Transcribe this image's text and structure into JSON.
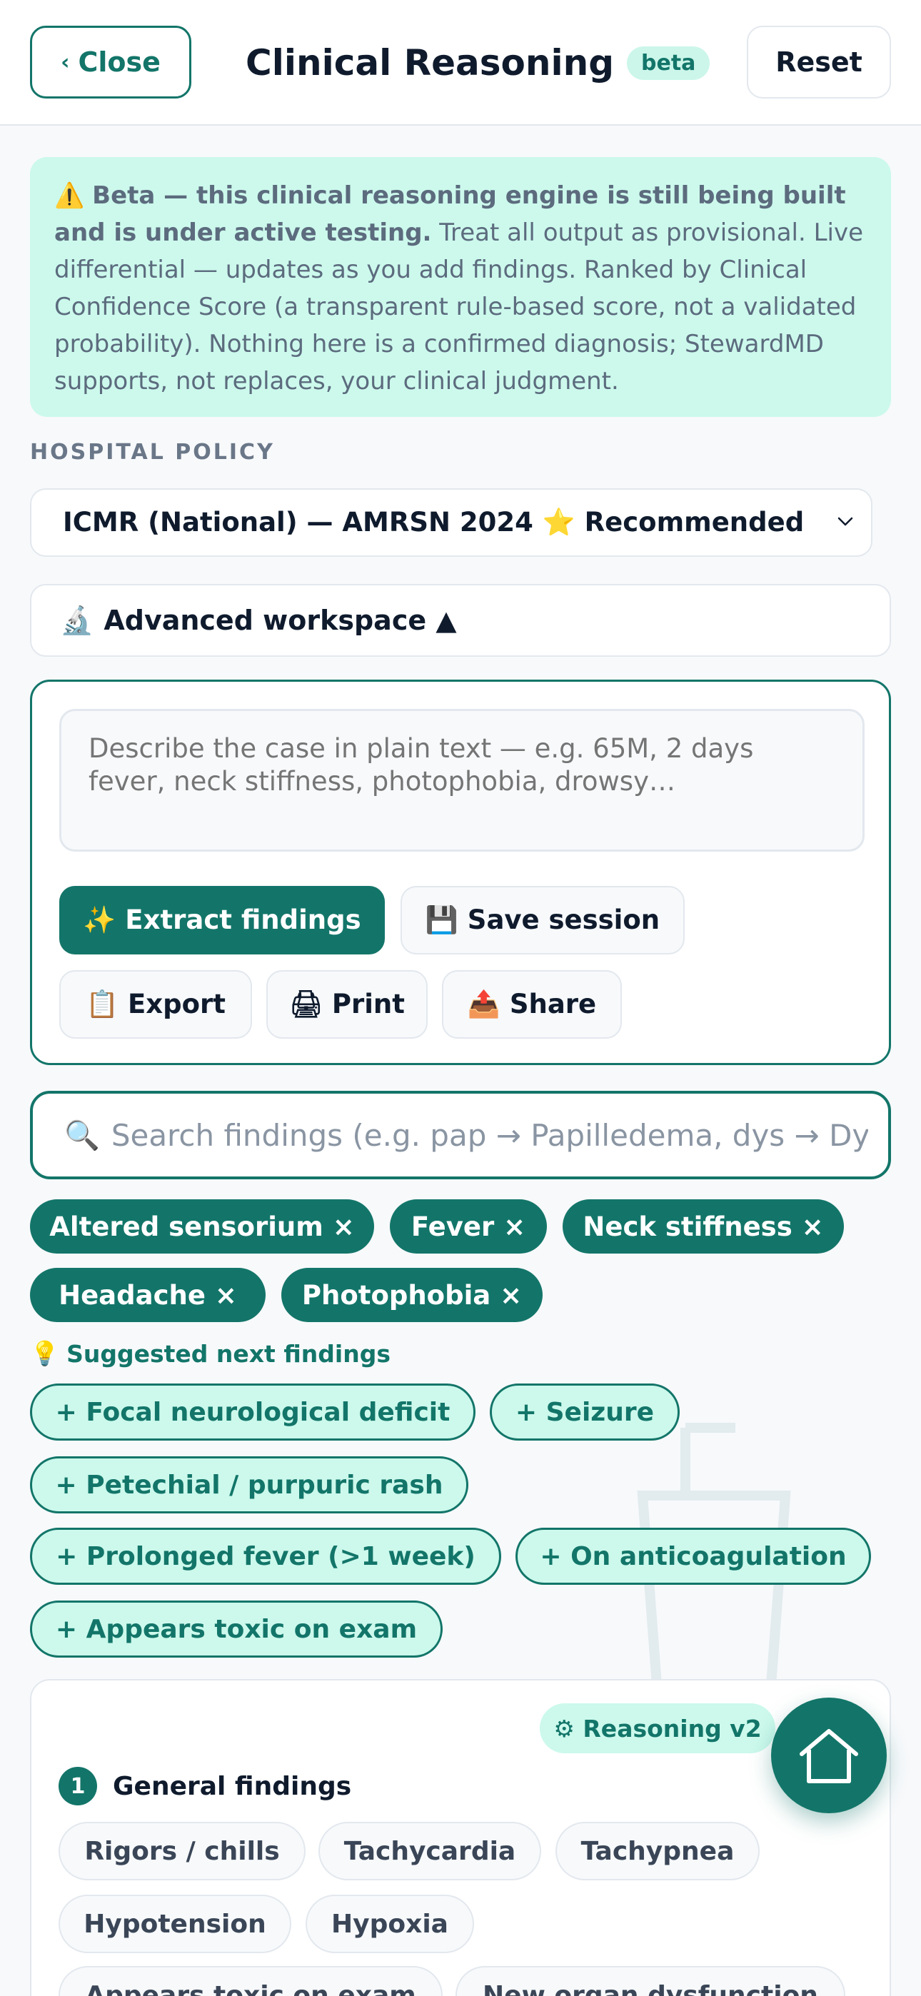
{
  "header": {
    "close_label": "Close",
    "close_chevron": "‹",
    "title": "Clinical Reasoning",
    "badge": "beta",
    "reset_label": "Reset"
  },
  "notice": {
    "icon": "⚠️",
    "bold_text": "Beta — this clinical reasoning engine is still being built and is under active testing.",
    "text": " Treat all output as provisional. Live differential — updates as you add findings. Ranked by Clinical Confidence Score (a transparent rule-based score, not a validated probability). Nothing here is a confirmed diagnosis; StewardMD supports, not replaces, your clinical judgment."
  },
  "policy": {
    "label": "HOSPITAL POLICY",
    "selected": "ICMR (National) — AMRSN 2024 ⭐ Recommended"
  },
  "advanced": {
    "icon": "🔬",
    "label": "Advanced workspace ▲"
  },
  "case": {
    "placeholder": "Describe the case in plain text — e.g. 65M, 2 days fever, neck stiffness, photophobia, drowsy…",
    "extract_label": "✨ Extract findings",
    "save_label": "💾 Save session",
    "export_label": "📋 Export",
    "print_label": "🖨 Print",
    "share_label": "📤 Share"
  },
  "search": {
    "icon": "🔍",
    "placeholder": "Search findings (e.g. pap → Papilledema, dys → Dysarthria)"
  },
  "selected_findings": [
    "Altered sensorium ×",
    "Fever ×",
    "Neck stiffness ×",
    "Headache ×",
    "Photophobia ×"
  ],
  "suggested": {
    "icon": "💡",
    "label": "Suggested next findings",
    "items": [
      "+ Focal neurological deficit",
      "+ Seizure",
      "+ Petechial / purpuric rash",
      "+ Prolonged fever (>1 week)",
      "+ On anticoagulation",
      "+ Appears toxic on exam"
    ]
  },
  "reasoning": {
    "badge": "⚙ Reasoning v2",
    "step_number": "1",
    "step_title": "General findings",
    "chips": [
      "Rigors / chills",
      "Tachycardia",
      "Tachypnea",
      "Hypotension",
      "Hypoxia",
      "Appears toxic on exam",
      "New organ dysfunction"
    ]
  },
  "colors": {
    "accent": "#137569",
    "accent_light": "#ccf9ec",
    "border": "#e3e8ee",
    "muted_text": "#5c6b7e"
  }
}
